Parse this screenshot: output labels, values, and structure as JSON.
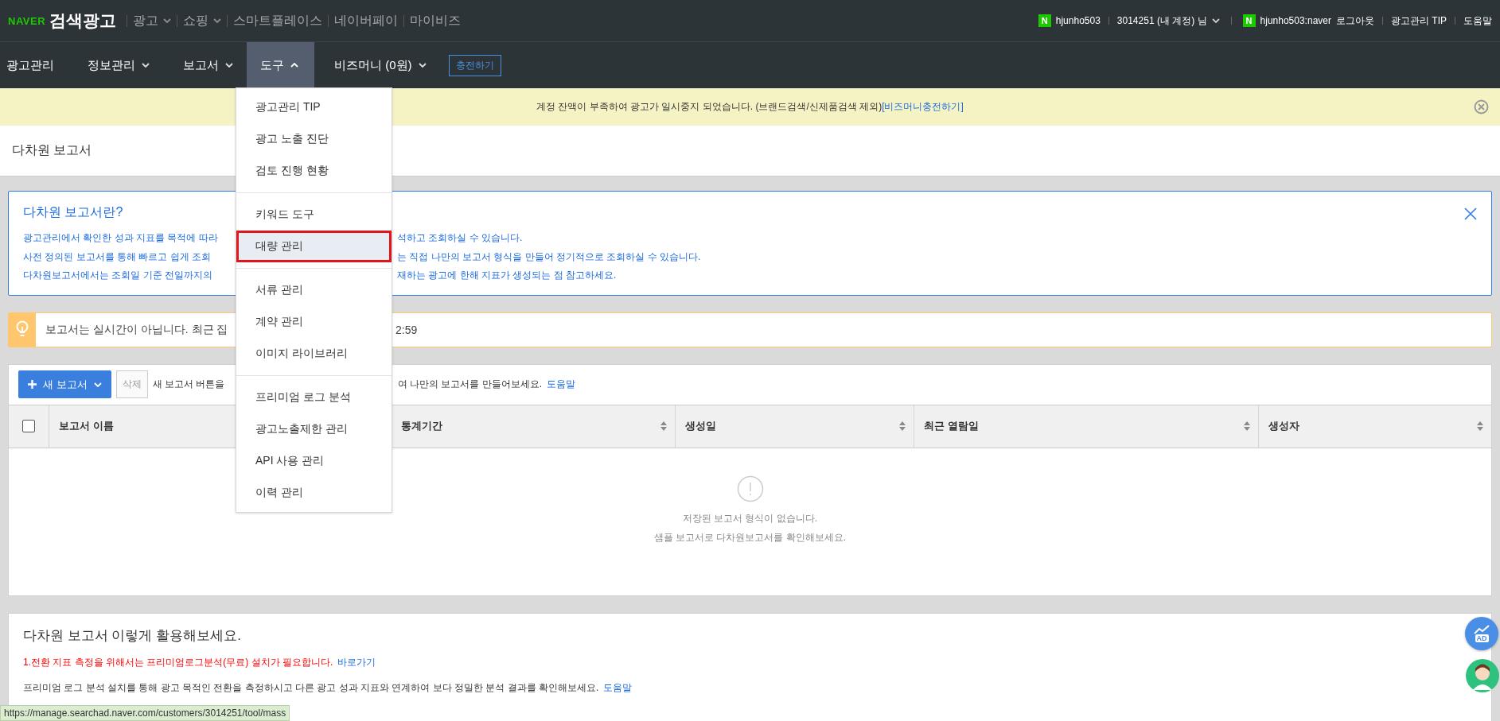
{
  "top_bar": {
    "brand": "NAVER",
    "product": "검색광고",
    "links": [
      {
        "label": "광고",
        "dropdown": true
      },
      {
        "label": "쇼핑",
        "dropdown": true
      },
      {
        "label": "스마트플레이스",
        "dropdown": false
      },
      {
        "label": "네이버페이",
        "dropdown": false
      },
      {
        "label": "마이비즈",
        "dropdown": false
      }
    ],
    "account": {
      "badge": "N",
      "user": "hjunho503",
      "customer": "3014251 (내 계정) 님"
    },
    "login": {
      "badge": "N",
      "user": "hjunho503:naver",
      "logout": "로그아웃"
    },
    "tip": "광고관리 TIP",
    "help": "도움말"
  },
  "nav": {
    "items": [
      {
        "label": "광고관리",
        "dropdown": false,
        "selected": false
      },
      {
        "label": "정보관리",
        "dropdown": true,
        "selected": false,
        "expanded": false
      },
      {
        "label": "보고서",
        "dropdown": true,
        "selected": false,
        "expanded": false
      },
      {
        "label": "도구",
        "dropdown": true,
        "selected": true,
        "expanded": true
      },
      {
        "label": "비즈머니 (0원)",
        "dropdown": true,
        "selected": false,
        "expanded": false
      }
    ],
    "charge_button": "충전하기"
  },
  "banner": {
    "message": "계정 잔액이 부족하여 광고가 일시중지 되었습니다. (브랜드검색/신제품검색 제외)",
    "link": "[비즈머니충전하기]"
  },
  "menu": {
    "groups": [
      {
        "items": [
          {
            "label": "광고관리 TIP",
            "selected": false
          },
          {
            "label": "광고 노출 진단",
            "selected": false
          },
          {
            "label": "검토 진행 현황",
            "selected": false
          }
        ]
      },
      {
        "items": [
          {
            "label": "키워드 도구",
            "selected": false
          },
          {
            "label": "대량 관리",
            "selected": true
          }
        ]
      },
      {
        "items": [
          {
            "label": "서류 관리",
            "selected": false
          },
          {
            "label": "계약 관리",
            "selected": false
          },
          {
            "label": "이미지 라이브러리",
            "selected": false
          }
        ]
      },
      {
        "items": [
          {
            "label": "프리미엄 로그 분석",
            "selected": false
          },
          {
            "label": "광고노출제한 관리",
            "selected": false
          },
          {
            "label": "API 사용 관리",
            "selected": false
          },
          {
            "label": "이력 관리",
            "selected": false
          }
        ]
      }
    ]
  },
  "page_title": "다차원 보고서",
  "info": {
    "title": "다차원 보고서란?",
    "lines": [
      {
        "left": "광고관리에서 확인한 성과 지표를 목적에 따라",
        "right": "석하고 조회하실 수 있습니다."
      },
      {
        "left": "사전 정의된 보고서를 통해 빠르고 쉽게 조회",
        "right": "는 직접 나만의 보고서 형식을 만들어 정기적으로 조회하실 수 있습니다."
      },
      {
        "left": "다차원보고서에서는 조회일 기준 전일까지의",
        "right": "재하는 광고에 한해 지표가 생성되는 점 참고하세요."
      }
    ]
  },
  "notice": {
    "left": "보고서는 실시간이 아닙니다. 최근 집",
    "right": "2:59"
  },
  "toolbar": {
    "new_button": "새 보고서",
    "delete_button": "삭제",
    "hint_left": "새 보고서 버튼을",
    "hint_right": "여 나만의 보고서를 만들어보세요.",
    "help_link": "도움말"
  },
  "table": {
    "columns": [
      {
        "kind": "checkbox",
        "checked": false
      },
      {
        "kind": "text",
        "label": "보고서 이름"
      },
      {
        "kind": "text",
        "label": "통계기간",
        "sortable": true
      },
      {
        "kind": "text",
        "label": "생성일",
        "sortable": true
      },
      {
        "kind": "text",
        "label": "최근 열람일",
        "sortable": true
      },
      {
        "kind": "text",
        "label": "생성자",
        "sortable": true
      }
    ],
    "empty": {
      "message": "저장된 보고서 형식이 없습니다.",
      "hint": "샘플 보고서로 다차원보고서를 확인해보세요."
    }
  },
  "guide": {
    "title": "다차원 보고서 이렇게 활용해보세요.",
    "items": [
      {
        "kind": "warning",
        "text": "1.전환 지표 측정을 위해서는 프리미엄로그분석(무료) 설치가 필요합니다.",
        "link": "바로가기"
      },
      {
        "kind": "normal",
        "text": "프리미엄 로그 분석 설치를 통해 광고 목적인 전환을 측정하시고 다른 광고 성과 지표와 연계하여 보다 정밀한 분석 결과를 확인해보세요.",
        "link": "도움말"
      }
    ]
  },
  "ad_button": "AD",
  "status_bar": {
    "url": "https://manage.searchad.naver.com/customers/3014251/tool/mass"
  }
}
